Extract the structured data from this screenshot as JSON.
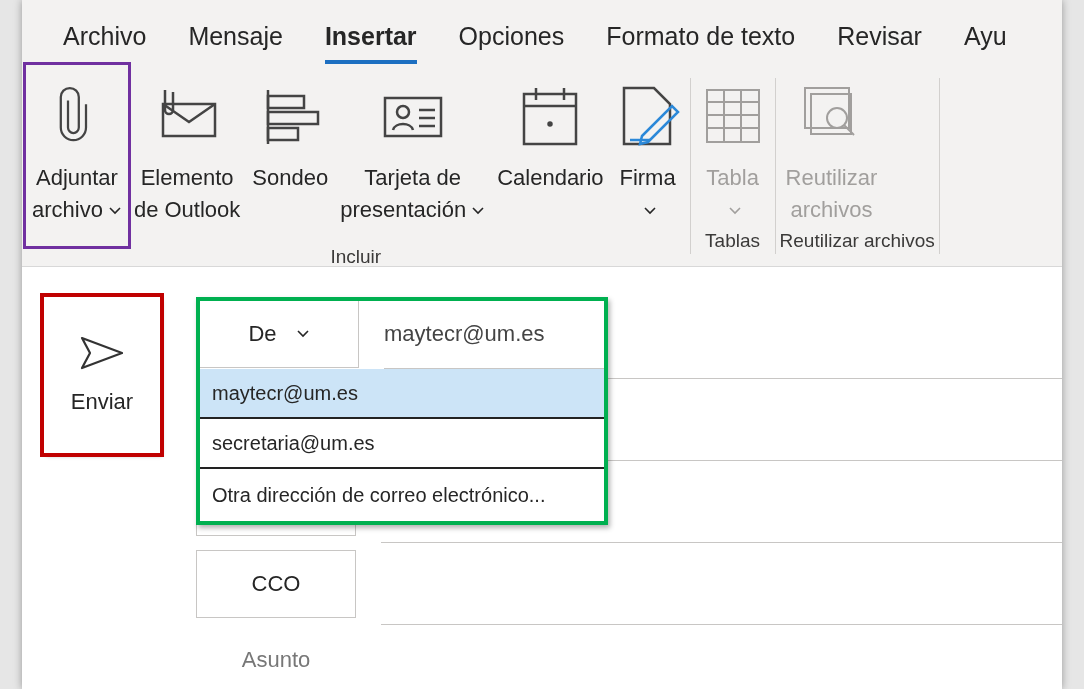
{
  "tabs": [
    {
      "label": "Archivo",
      "selected": false
    },
    {
      "label": "Mensaje",
      "selected": false
    },
    {
      "label": "Insertar",
      "selected": true
    },
    {
      "label": "Opciones",
      "selected": false
    },
    {
      "label": "Formato de texto",
      "selected": false
    },
    {
      "label": "Revisar",
      "selected": false
    },
    {
      "label": "Ayu",
      "selected": false
    }
  ],
  "ribbon_groups": [
    {
      "label": "Incluir",
      "buttons": [
        {
          "kind": "paperclip",
          "lines": [
            "Adjuntar",
            "archivo"
          ],
          "dropdown": true,
          "disabled": false,
          "highlight": {
            "color": "#7030a0"
          }
        },
        {
          "kind": "item",
          "lines": [
            "Elemento",
            "de Outlook"
          ],
          "dropdown": false,
          "disabled": false
        },
        {
          "kind": "poll",
          "lines": [
            "Sondeo"
          ],
          "dropdown": false,
          "disabled": false
        },
        {
          "kind": "card",
          "lines": [
            "Tarjeta de",
            "presentación"
          ],
          "dropdown": true,
          "disabled": false
        },
        {
          "kind": "calendar",
          "lines": [
            "Calendario"
          ],
          "dropdown": false,
          "disabled": false
        },
        {
          "kind": "signature",
          "lines": [
            "Firma"
          ],
          "dropdown": true,
          "disabled": false
        }
      ]
    },
    {
      "label": "Tablas",
      "buttons": [
        {
          "kind": "table",
          "lines": [
            "Tabla"
          ],
          "dropdown": true,
          "disabled": true
        }
      ]
    },
    {
      "label": "Reutilizar archivos",
      "buttons": [
        {
          "kind": "reuse",
          "lines": [
            "Reutilizar",
            "archivos"
          ],
          "dropdown": false,
          "disabled": true
        }
      ]
    }
  ],
  "send_button": {
    "label": "Enviar",
    "highlight": {
      "color": "#c00000"
    }
  },
  "from": {
    "label": "De",
    "value": "maytecr@um.es",
    "expanded": true,
    "highlight": {
      "color": "#00b050"
    },
    "options": [
      {
        "label": "maytecr@um.es",
        "selected": true
      },
      {
        "label": "secretaria@um.es",
        "selected": false
      },
      {
        "label": "Otra dirección de correo electrónico...",
        "selected": false
      }
    ]
  },
  "bcc_button": {
    "label": "CCO"
  },
  "subject": {
    "label": "Asunto"
  }
}
